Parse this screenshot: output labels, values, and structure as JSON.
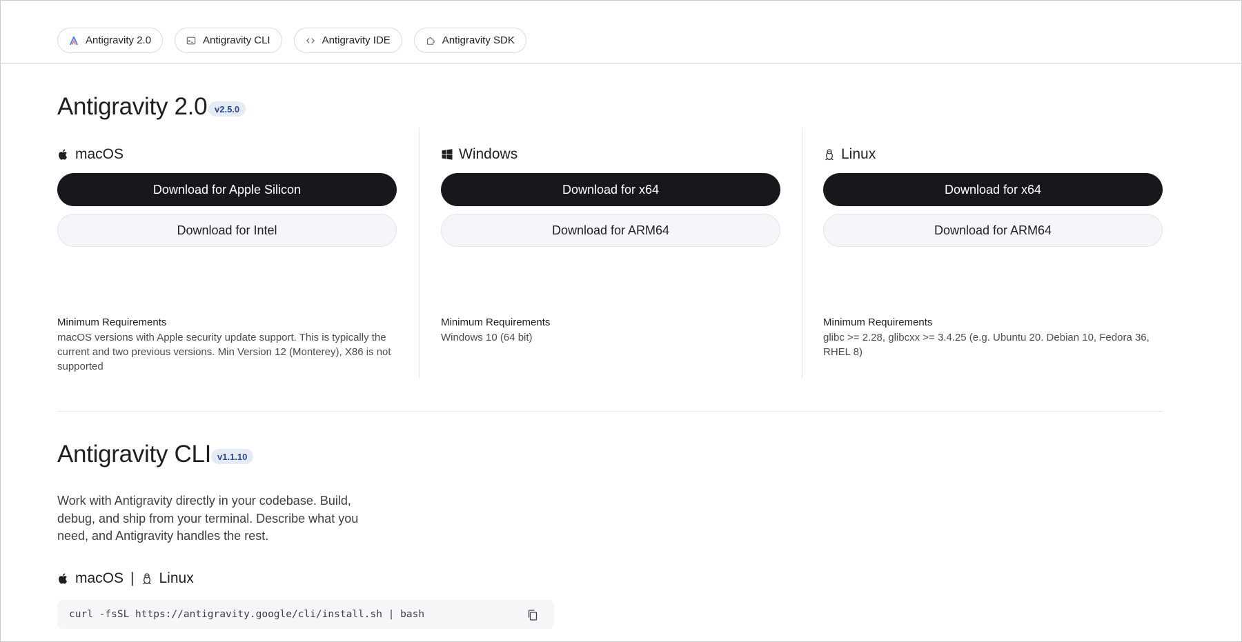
{
  "tabs": [
    {
      "label": "Antigravity 2.0",
      "icon": "antigravity-logo-icon"
    },
    {
      "label": "Antigravity CLI",
      "icon": "terminal-icon"
    },
    {
      "label": "Antigravity IDE",
      "icon": "code-icon"
    },
    {
      "label": "Antigravity SDK",
      "icon": "puzzle-icon"
    }
  ],
  "app": {
    "title": "Antigravity 2.0",
    "version": "v2.5.0",
    "platforms": [
      {
        "name": "macOS",
        "icon": "apple-icon",
        "primary_button": "Download for Apple Silicon",
        "secondary_button": "Download for Intel",
        "requirements_title": "Minimum Requirements",
        "requirements_text": "macOS versions with Apple security update support. This is typically the current and two previous versions. Min Version 12 (Monterey), X86 is not supported"
      },
      {
        "name": "Windows",
        "icon": "windows-icon",
        "primary_button": "Download for x64",
        "secondary_button": "Download for ARM64",
        "requirements_title": "Minimum Requirements",
        "requirements_text": "Windows 10 (64 bit)"
      },
      {
        "name": "Linux",
        "icon": "linux-icon",
        "primary_button": "Download for x64",
        "secondary_button": "Download for ARM64",
        "requirements_title": "Minimum Requirements",
        "requirements_text": "glibc >= 2.28, glibcxx >= 3.4.25 (e.g. Ubuntu 20. Debian 10, Fedora 36, RHEL 8)"
      }
    ]
  },
  "cli": {
    "title": "Antigravity CLI",
    "version": "v1.1.10",
    "description": "Work with Antigravity directly in your codebase. Build, debug, and ship from your terminal. Describe what you need, and Antigravity handles the rest.",
    "platform_macos": "macOS",
    "separator": "|",
    "platform_linux": "Linux",
    "install_command": "curl -fsSL https://antigravity.google/cli/install.sh | bash",
    "copy_icon": "copy-icon"
  },
  "colors": {
    "primary_button_bg": "#17181b",
    "secondary_button_bg": "#f5f6f9",
    "version_badge_bg": "#e6eaf4",
    "version_badge_text": "#274a8f"
  }
}
